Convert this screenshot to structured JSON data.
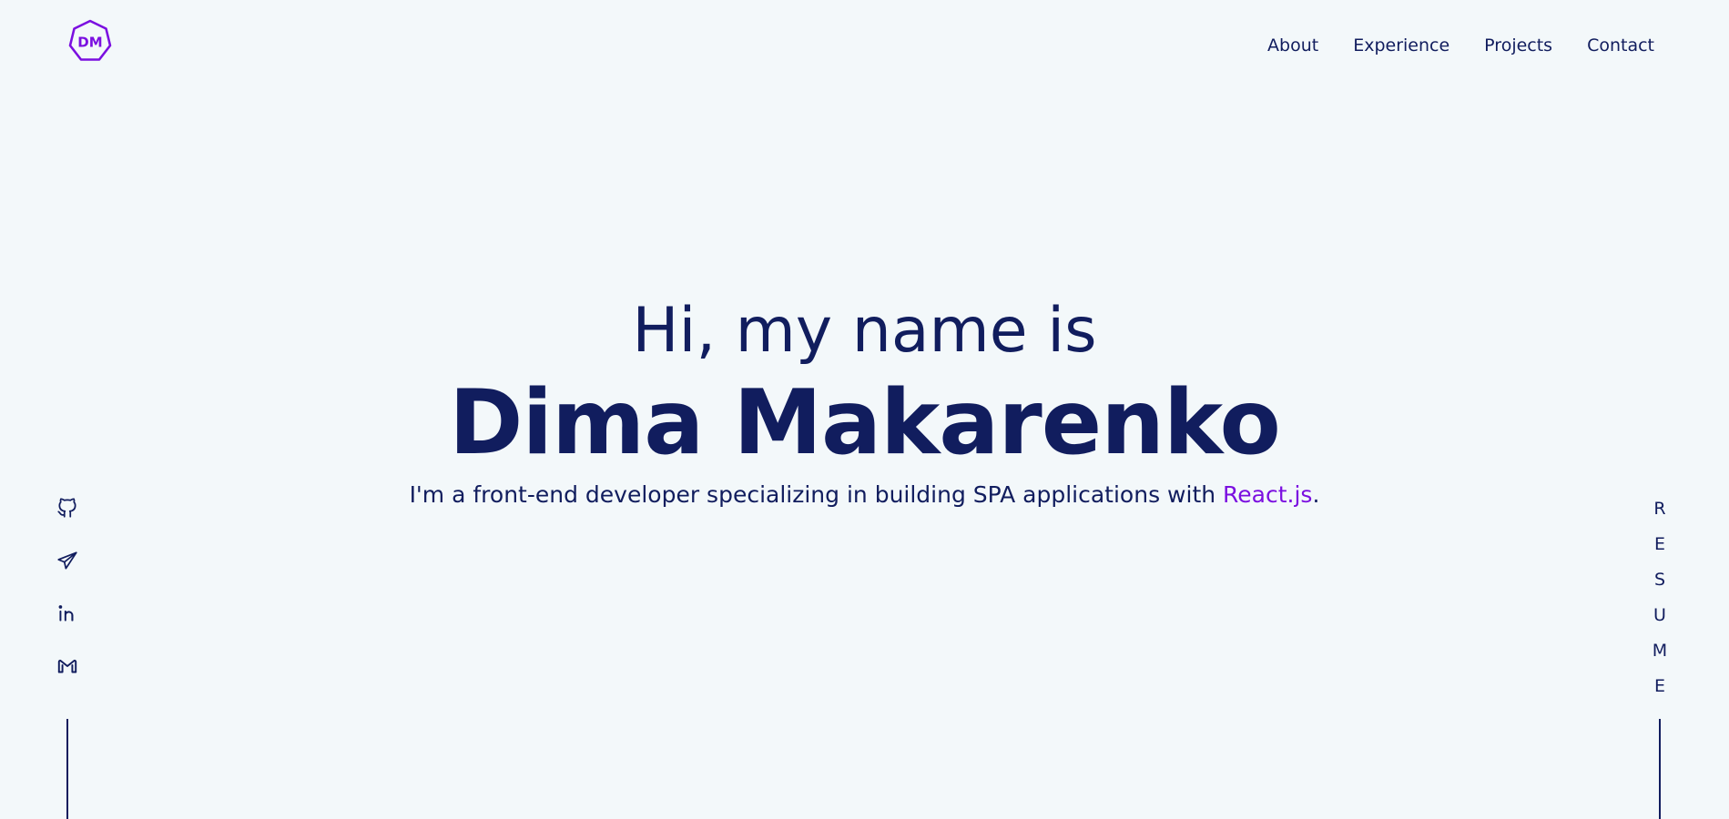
{
  "logo": {
    "text": "DM",
    "color": "#7b0fe0"
  },
  "nav": {
    "items": [
      {
        "label": "About"
      },
      {
        "label": "Experience"
      },
      {
        "label": "Projects"
      },
      {
        "label": "Contact"
      }
    ]
  },
  "hero": {
    "greeting": "Hi, my name is",
    "name": "Dima Makarenko",
    "tagline_prefix": "I'm a front-end developer specializing in building SPA applications with ",
    "tagline_highlight": "React.js",
    "tagline_suffix": "."
  },
  "socials": [
    {
      "icon": "github-icon"
    },
    {
      "icon": "telegram-icon"
    },
    {
      "icon": "linkedin-icon"
    },
    {
      "icon": "gmail-icon"
    }
  ],
  "resume": {
    "letters": [
      "R",
      "E",
      "S",
      "U",
      "M",
      "E"
    ]
  },
  "colors": {
    "background": "#f3f8fa",
    "text": "#111d5e",
    "accent": "#7b0fe0"
  }
}
